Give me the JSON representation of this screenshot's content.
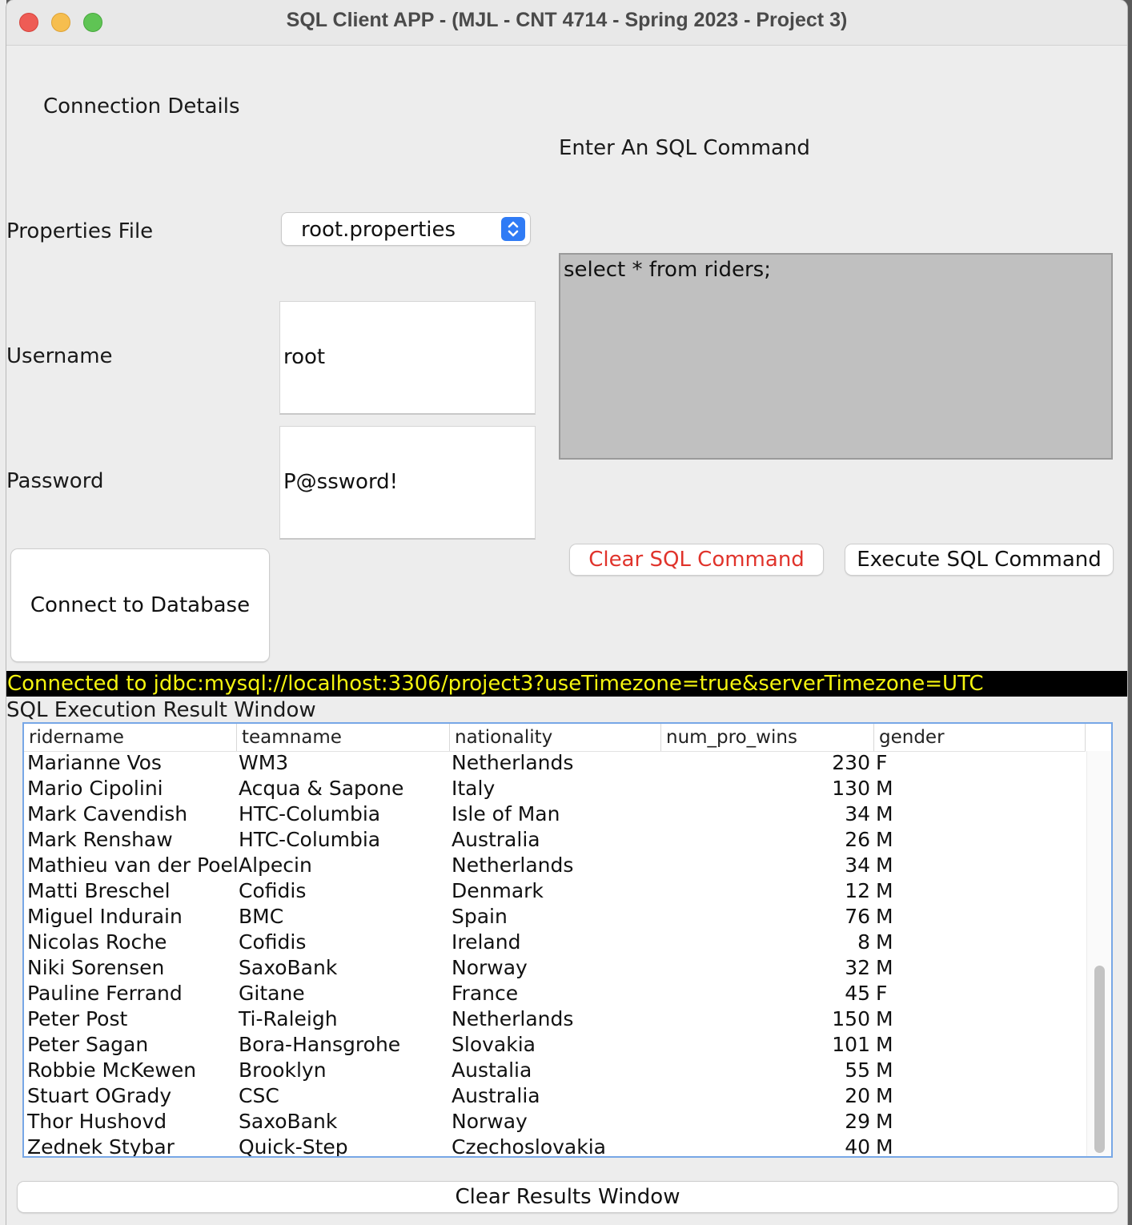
{
  "window": {
    "title": "SQL Client APP - (MJL - CNT 4714 - Spring 2023 - Project 3)"
  },
  "connection": {
    "section_title": "Connection Details",
    "properties_label": "Properties File",
    "properties_value": "root.properties",
    "username_label": "Username",
    "username_value": "root",
    "password_label": "Password",
    "password_value": "P@ssword!",
    "connect_button": "Connect to Database"
  },
  "sql": {
    "section_title": "Enter An SQL Command",
    "command_text": "select * from riders;",
    "clear_button": "Clear SQL Command",
    "execute_button": "Execute SQL Command"
  },
  "status": {
    "text": "Connected to jdbc:mysql://localhost:3306/project3?useTimezone=true&serverTimezone=UTC"
  },
  "results": {
    "title": "SQL Execution Result Window",
    "columns": [
      "ridername",
      "teamname",
      "nationality",
      "num_pro_wins",
      "gender"
    ],
    "rows": [
      [
        "Marianne Vos",
        "WM3",
        "Netherlands",
        "230",
        "F"
      ],
      [
        "Mario Cipolini",
        "Acqua & Sapone",
        "Italy",
        "130",
        "M"
      ],
      [
        "Mark Cavendish",
        "HTC-Columbia",
        "Isle of Man",
        "34",
        "M"
      ],
      [
        "Mark Renshaw",
        "HTC-Columbia",
        "Australia",
        "26",
        "M"
      ],
      [
        "Mathieu van der Poel",
        "Alpecin",
        "Netherlands",
        "34",
        "M"
      ],
      [
        "Matti Breschel",
        "Cofidis",
        "Denmark",
        "12",
        "M"
      ],
      [
        "Miguel Indurain",
        "BMC",
        "Spain",
        "76",
        "M"
      ],
      [
        "Nicolas Roche",
        "Cofidis",
        "Ireland",
        "8",
        "M"
      ],
      [
        "Niki Sorensen",
        "SaxoBank",
        "Norway",
        "32",
        "M"
      ],
      [
        "Pauline Ferrand",
        "Gitane",
        "France",
        "45",
        "F"
      ],
      [
        "Peter Post",
        "Ti-Raleigh",
        "Netherlands",
        "150",
        "M"
      ],
      [
        "Peter Sagan",
        "Bora-Hansgrohe",
        "Slovakia",
        "101",
        "M"
      ],
      [
        "Robbie McKewen",
        "Brooklyn",
        "Austalia",
        "55",
        "M"
      ],
      [
        "Stuart OGrady",
        "CSC",
        "Australia",
        "20",
        "M"
      ],
      [
        "Thor Hushovd",
        "SaxoBank",
        "Norway",
        "29",
        "M"
      ],
      [
        "Zednek Stybar",
        "Quick-Step",
        "Czechoslovakia",
        "40",
        "M"
      ]
    ],
    "clear_button": "Clear Results Window"
  },
  "icons": {
    "select_arrows": "up-down-chevron-icon"
  },
  "colors": {
    "status_bg": "#000000",
    "status_text": "#f5f510",
    "clear_sql_text": "#e0332b",
    "select_accent": "#2f7bf5",
    "sql_area_bg": "#c0c0c0",
    "table_border": "#77a7e6"
  }
}
